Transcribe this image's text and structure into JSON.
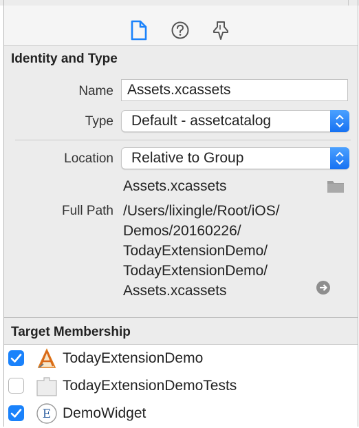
{
  "inspector_tabs": [
    {
      "name": "File inspector",
      "icon": "document-icon",
      "active": true
    },
    {
      "name": "Quick Help inspector",
      "icon": "help-icon",
      "active": false
    },
    {
      "name": "Upstream inspector",
      "icon": "pin-icon",
      "active": false
    }
  ],
  "identity": {
    "header": "Identity and Type",
    "name_label": "Name",
    "name_value": "Assets.xcassets",
    "type_label": "Type",
    "type_value": "Default - assetcatalog",
    "location_label": "Location",
    "location_value": "Relative to Group",
    "location_filename": "Assets.xcassets",
    "full_path_label": "Full Path",
    "full_path_lines": [
      "/Users/lixingle/Root/iOS/",
      "Demos/20160226/",
      "TodayExtensionDemo/",
      "TodayExtensionDemo/",
      "Assets.xcassets"
    ]
  },
  "target_membership": {
    "header": "Target Membership",
    "targets": [
      {
        "label": "TodayExtensionDemo",
        "checked": true,
        "icon": "app-target-icon"
      },
      {
        "label": "TodayExtensionDemoTests",
        "checked": false,
        "icon": "test-bundle-icon"
      },
      {
        "label": "DemoWidget",
        "checked": true,
        "icon": "extension-icon"
      }
    ]
  },
  "colors": {
    "accent": "#1a82fb",
    "panel_bg": "#ececec"
  }
}
